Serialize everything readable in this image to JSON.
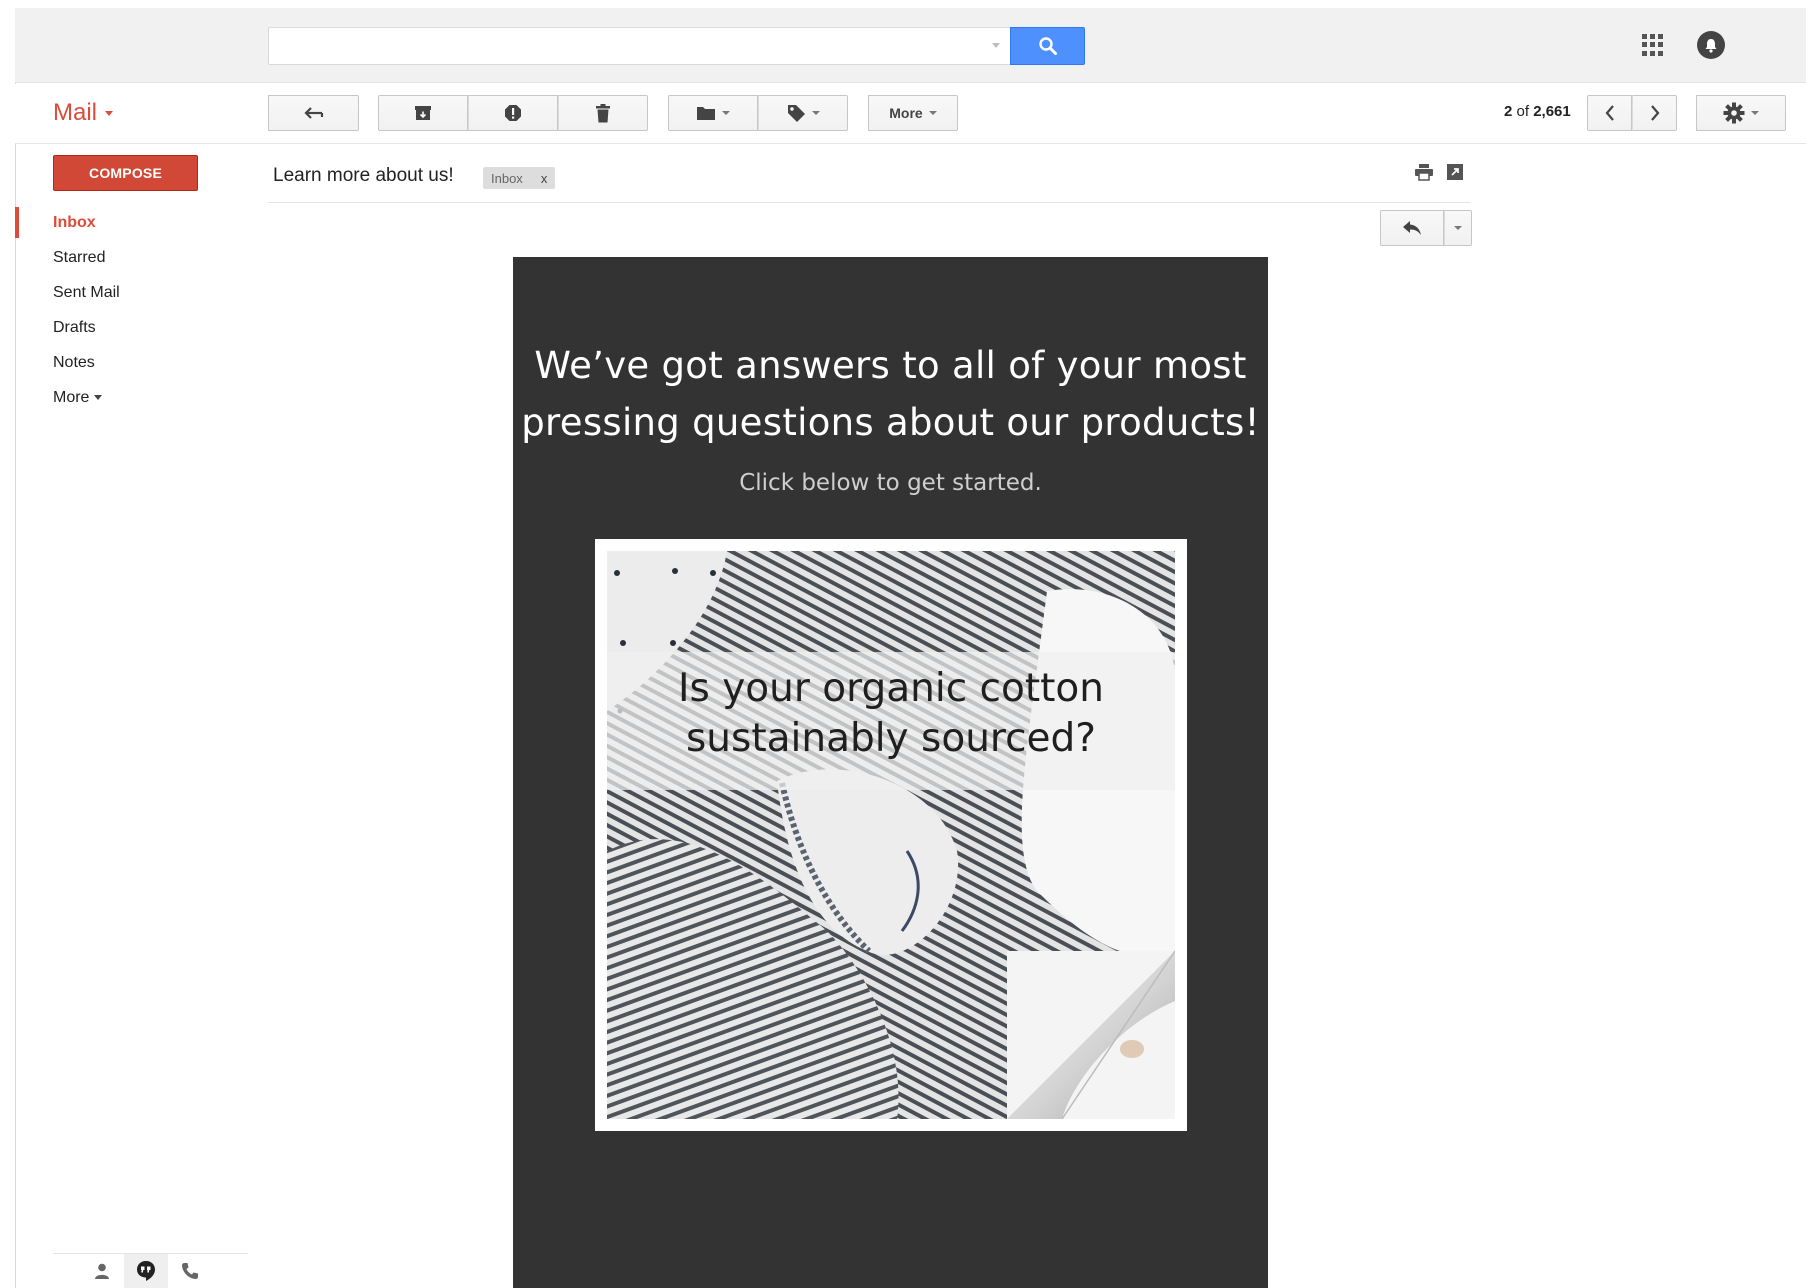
{
  "search": {
    "value": "",
    "placeholder": ""
  },
  "icons": {
    "search": "search-icon",
    "apps": "apps-grid-icon",
    "notifications": "notifications-bell-icon",
    "back": "back-arrow-icon",
    "archive": "archive-icon",
    "spam": "report-spam-icon",
    "delete": "trash-icon",
    "move": "folder-icon",
    "labels": "label-tag-icon",
    "prev": "chevron-left-icon",
    "next": "chevron-right-icon",
    "settings": "gear-icon",
    "print": "print-icon",
    "new_window": "new-window-icon",
    "reply": "reply-icon",
    "contacts": "person-icon",
    "hangouts": "hangouts-icon",
    "phone": "phone-icon"
  },
  "app": {
    "title": "Mail"
  },
  "toolbar": {
    "more_label": "More"
  },
  "pager": {
    "current": "2",
    "of_label": "of",
    "total": "2,661"
  },
  "sidebar": {
    "compose_label": "COMPOSE",
    "items": [
      {
        "label": "Inbox",
        "active": true
      },
      {
        "label": "Starred",
        "active": false
      },
      {
        "label": "Sent Mail",
        "active": false
      },
      {
        "label": "Drafts",
        "active": false
      },
      {
        "label": "Notes",
        "active": false
      }
    ],
    "more_label": "More"
  },
  "message": {
    "subject": "Learn more about us!",
    "label_chip": "Inbox",
    "label_remove": "x"
  },
  "email_body": {
    "headline_line1": "We’ve got answers to all of your most",
    "headline_line2": "pressing questions about our products!",
    "subheadline": "Click below to get started.",
    "image_text_line1": "Is your organic cotton",
    "image_text_line2": "sustainably sourced?"
  },
  "colors": {
    "brand_red": "#dd4b39",
    "compose_red": "#d14836",
    "search_blue": "#4d90fe",
    "email_bg": "#333333"
  }
}
